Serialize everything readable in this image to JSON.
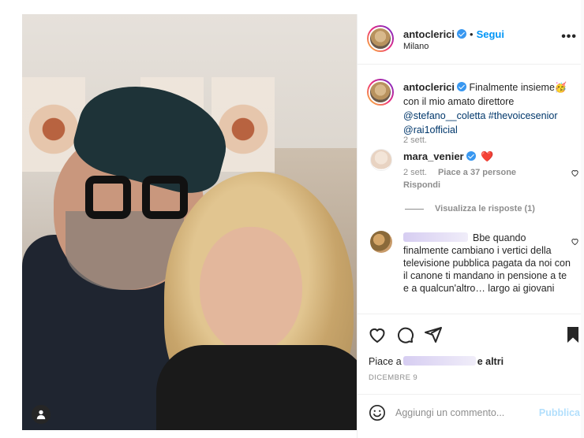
{
  "post": {
    "author": "antoclerici",
    "verified": true,
    "follow_label": "Segui",
    "separator": "•",
    "location": "Milano",
    "more_label": "•••"
  },
  "caption": {
    "author": "antoclerici",
    "text_start": "Finalmente insieme",
    "emoji": "🥳",
    "text_mid": "con il mio amato direttore",
    "mention_1": "@stefano__coletta",
    "hashtag": "#thevoicesenior",
    "mention_2": "@rai1official",
    "time": "2 sett."
  },
  "comments": [
    {
      "author": "mara_venier",
      "verified": true,
      "text": "❤️",
      "time": "2 sett.",
      "likes": "Piace a 37 persone",
      "reply_label": "Rispondi",
      "view_replies": "Visualizza le risposte (1)"
    },
    {
      "author_redacted": true,
      "text": "Bbe quando finalmente cambiano i vertici della televisione pubblica pagata da noi con il canone ti mandano in pensione a te e a qualcun'altro… largo ai giovani"
    }
  ],
  "likes_line": {
    "prefix": "Piace a",
    "suffix": "e altri"
  },
  "date": "DICEMBRE 9",
  "comment_box": {
    "placeholder": "Aggiungi un commento...",
    "publish_label": "Pubblica"
  },
  "icons": {
    "like": "heart-icon",
    "comment": "comment-icon",
    "share": "paper-plane-icon",
    "save": "bookmark-icon",
    "emoji": "emoji-icon",
    "user_tag": "user-tag-icon"
  },
  "colors": {
    "accent": "#0095f6",
    "verified": "#3897f0",
    "heart": "#ed4956",
    "muted": "#8e8e8e",
    "link": "#00376b"
  }
}
